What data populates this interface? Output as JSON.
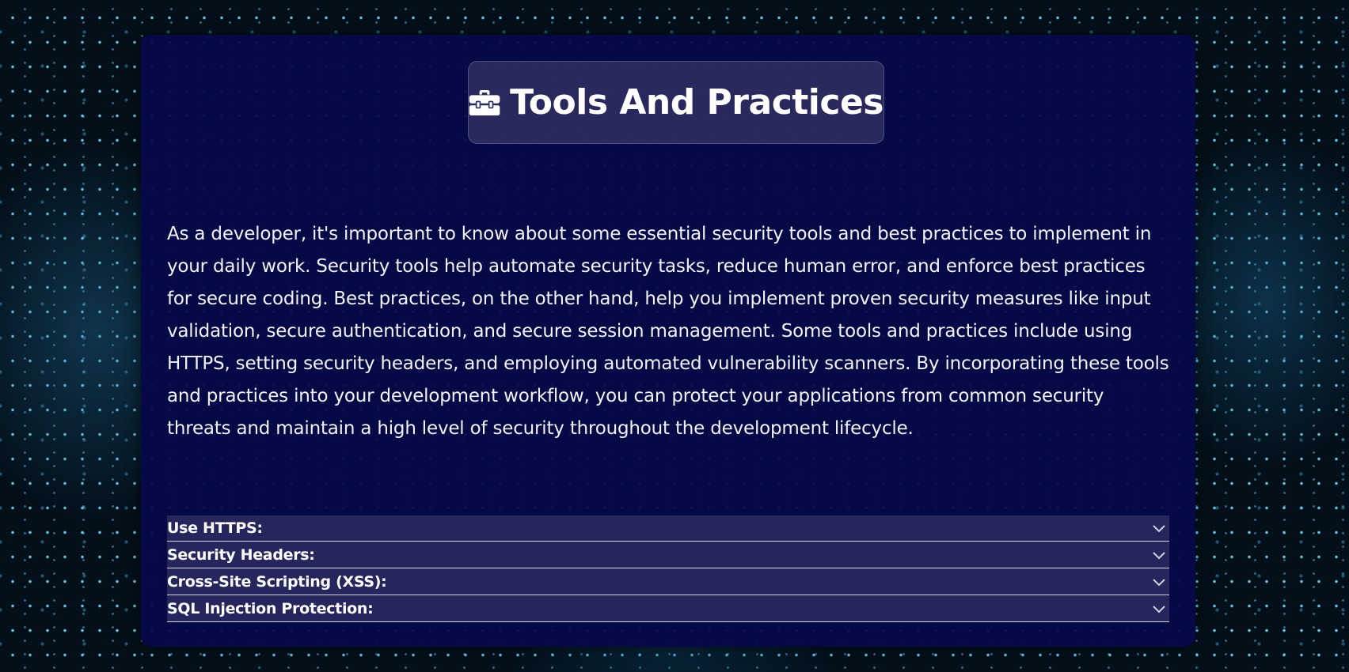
{
  "section": {
    "icon": "toolbox-icon",
    "title": "Tools And Practices",
    "intro": "As a developer, it's important to know about some essential security tools and best practices to implement in your daily work. Security tools help automate security tasks, reduce human error, and enforce best practices for secure coding. Best practices, on the other hand, help you implement proven security measures like input validation, secure authentication, and secure session management. Some tools and practices include using HTTPS, setting security headers, and employing automated vulnerability scanners. By incorporating these tools and practices into your development workflow, you can protect your applications from common security threats and maintain a high level of security throughout the development lifecycle."
  },
  "accordion": {
    "items": [
      {
        "label": "Use HTTPS:",
        "icon": "chevron-down-icon"
      },
      {
        "label": "Security Headers:",
        "icon": "chevron-down-icon"
      },
      {
        "label": "Cross-Site Scripting (XSS):",
        "icon": "chevron-down-icon"
      },
      {
        "label": "SQL Injection Protection:",
        "icon": "chevron-down-icon"
      }
    ]
  },
  "colors": {
    "card_background": "#050848",
    "title_box_background": "#2d2d5f",
    "accordion_background": "#28285f",
    "text": "#ffffff"
  }
}
